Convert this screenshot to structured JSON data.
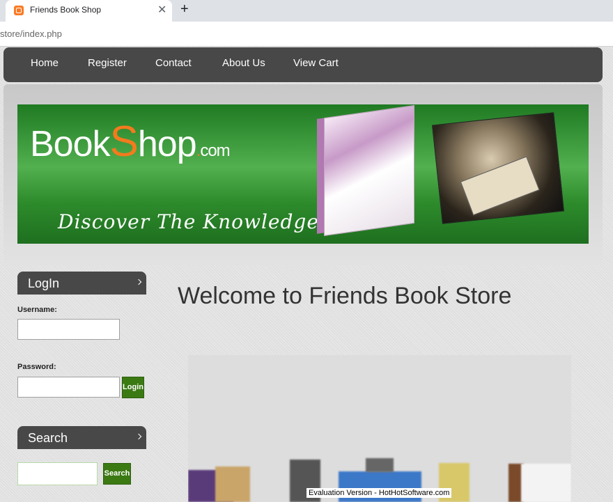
{
  "browser": {
    "tab_title": "Friends Book Shop",
    "url": "store/index.php",
    "close_glyph": "✕",
    "new_tab_glyph": "+"
  },
  "nav": {
    "items": [
      "Home",
      "Register",
      "Contact",
      "About Us",
      "View Cart"
    ]
  },
  "banner": {
    "logo_book": "Book",
    "logo_s": "S",
    "logo_hop": "hop",
    "logo_dot": ".",
    "logo_com": "com",
    "tagline": "Discover The Knowledge"
  },
  "login": {
    "heading": "LogIn",
    "username_label": "Username:",
    "password_label": "Password:",
    "button": "Login"
  },
  "search": {
    "heading": "Search",
    "button": "Search"
  },
  "main": {
    "welcome": "Welcome to Friends Book Store",
    "eval_notice": "Evaluation Version - HotHotSoftware.com"
  },
  "colors": {
    "nav_bg": "#484848",
    "banner_green": "#2e8c2c",
    "logo_orange": "#f47a1e",
    "button_green": "#3b7a13"
  }
}
